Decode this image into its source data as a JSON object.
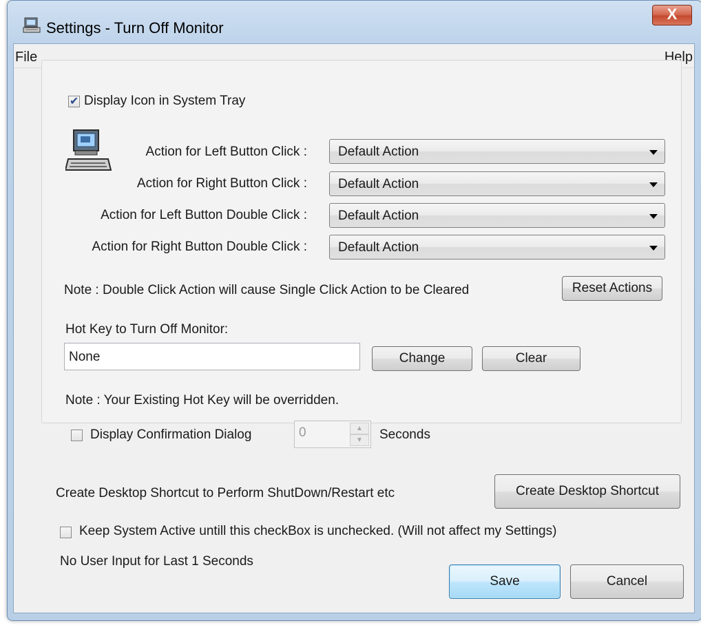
{
  "window": {
    "title": "Settings - Turn Off Monitor",
    "close_label": "X"
  },
  "menu": {
    "file": "File",
    "help": "Help"
  },
  "tray": {
    "checkbox_label": "Display Icon in System Tray",
    "checked": true,
    "icon": "computer-icon",
    "actions": [
      {
        "label": "Action for Left Button Click :",
        "value": "Default Action"
      },
      {
        "label": "Action for Right Button Click :",
        "value": "Default Action"
      },
      {
        "label": "Action for Left Button Double Click :",
        "value": "Default Action"
      },
      {
        "label": "Action for Right Button Double Click :",
        "value": "Default Action"
      }
    ],
    "note": "Note : Double Click Action will cause Single Click Action to be Cleared",
    "reset_button": "Reset Actions"
  },
  "hotkey": {
    "label": "Hot Key to Turn Off Monitor:",
    "value": "None",
    "change_button": "Change",
    "clear_button": "Clear",
    "note": "Note : Your Existing Hot Key will be overridden.",
    "confirm_label": "Display Confirmation Dialog",
    "confirm_checked": false,
    "seconds_value": "0",
    "seconds_label": "Seconds"
  },
  "shortcut": {
    "label": "Create Desktop Shortcut to Perform ShutDown/Restart etc",
    "button": "Create Desktop Shortcut"
  },
  "keep_active": {
    "label": "Keep System Active untill this checkBox is unchecked.  (Will not affect my Settings)",
    "checked": false
  },
  "status": "No User Input for Last 1 Seconds",
  "footer": {
    "save": "Save",
    "cancel": "Cancel"
  }
}
